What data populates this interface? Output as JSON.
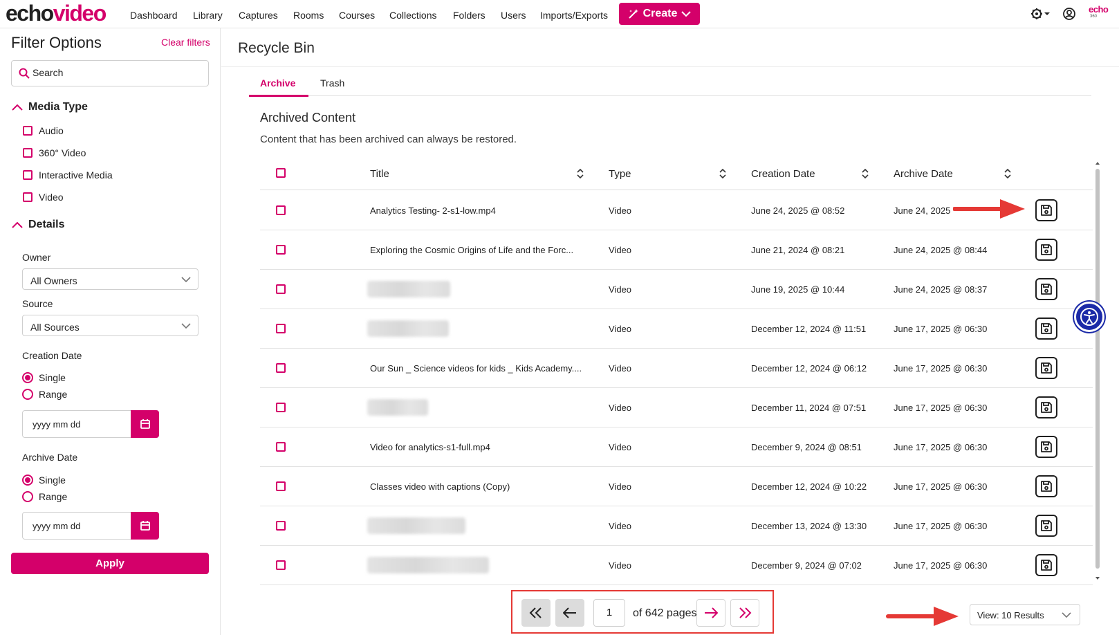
{
  "app": {
    "logo_echo": "echo",
    "logo_video": "video",
    "nav": [
      "Dashboard",
      "Library",
      "Captures",
      "Rooms",
      "Courses",
      "Collections",
      "Folders",
      "Users",
      "Imports/Exports"
    ],
    "create_label": "Create",
    "brand_badge": "echo",
    "brand_badge_sub": "360"
  },
  "sidebar": {
    "title": "Filter Options",
    "clear_filters": "Clear filters",
    "search_placeholder": "Search",
    "media_type": {
      "heading": "Media Type",
      "options": [
        "Audio",
        "360° Video",
        "Interactive Media",
        "Video"
      ]
    },
    "details": {
      "heading": "Details",
      "owner_label": "Owner",
      "owner_value": "All Owners",
      "source_label": "Source",
      "source_value": "All Sources",
      "creation_date_label": "Creation Date",
      "archive_date_label": "Archive Date",
      "single_label": "Single",
      "range_label": "Range",
      "date_placeholder": "yyyy mm dd"
    },
    "apply_label": "Apply"
  },
  "main": {
    "page_title": "Recycle Bin",
    "tabs": [
      "Archive",
      "Trash"
    ],
    "active_tab": "Archive",
    "section_title": "Archived Content",
    "section_desc": "Content that has been archived can always be restored.",
    "columns": [
      "Title",
      "Type",
      "Creation Date",
      "Archive Date"
    ],
    "rows": [
      {
        "title": "Analytics Testing- 2-s1-low.mp4",
        "type": "Video",
        "created": "June 24, 2025 @ 08:52",
        "archived": "June 24, 2025",
        "blurred": false
      },
      {
        "title": "Exploring the Cosmic Origins of Life and the Forc...",
        "type": "Video",
        "created": "June 21, 2024 @ 08:21",
        "archived": "June 24, 2025 @ 08:44",
        "blurred": false
      },
      {
        "title": "",
        "type": "Video",
        "created": "June 19, 2025 @ 10:44",
        "archived": "June 24, 2025 @ 08:37",
        "blurred": true
      },
      {
        "title": "",
        "type": "Video",
        "created": "December 12, 2024 @ 11:51",
        "archived": "June 17, 2025 @ 06:30",
        "blurred": true
      },
      {
        "title": "Our Sun _ Science videos for kids _ Kids Academy....",
        "type": "Video",
        "created": "December 12, 2024 @ 06:12",
        "archived": "June 17, 2025 @ 06:30",
        "blurred": false
      },
      {
        "title": "",
        "type": "Video",
        "created": "December 11, 2024 @ 07:51",
        "archived": "June 17, 2025 @ 06:30",
        "blurred": true
      },
      {
        "title": "Video for analytics-s1-full.mp4",
        "type": "Video",
        "created": "December 9, 2024 @ 08:51",
        "archived": "June 17, 2025 @ 06:30",
        "blurred": false
      },
      {
        "title": "Classes video with captions (Copy)",
        "type": "Video",
        "created": "December 12, 2024 @ 10:22",
        "archived": "June 17, 2025 @ 06:30",
        "blurred": false
      },
      {
        "title": "",
        "type": "Video",
        "created": "December 13, 2024 @ 13:30",
        "archived": "June 17, 2025 @ 06:30",
        "blurred": true
      },
      {
        "title": "",
        "type": "Video",
        "created": "December 9, 2024 @ 07:02",
        "archived": "June 17, 2025 @ 06:30",
        "blurred": true
      }
    ]
  },
  "pagination": {
    "current_page": "1",
    "of_pages": "of 642 pages",
    "view_results": "View: 10 Results"
  },
  "colors": {
    "accent": "#d4006a",
    "annotation": "#e53935",
    "accessibility": "#1b2aa8"
  }
}
